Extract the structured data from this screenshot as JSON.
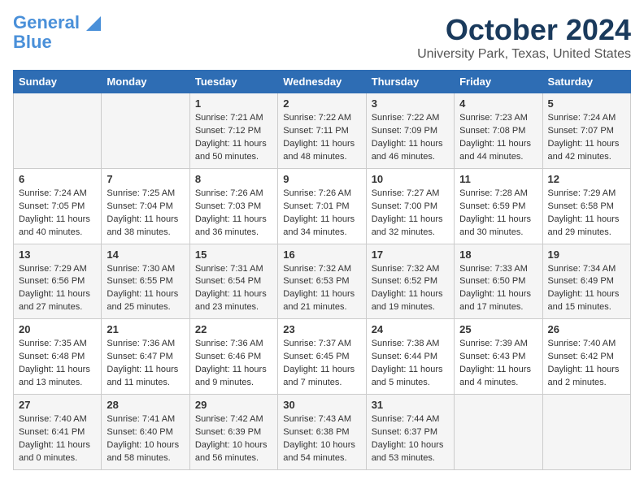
{
  "logo": {
    "line1": "General",
    "line2": "Blue"
  },
  "title": "October 2024",
  "location": "University Park, Texas, United States",
  "days_header": [
    "Sunday",
    "Monday",
    "Tuesday",
    "Wednesday",
    "Thursday",
    "Friday",
    "Saturday"
  ],
  "weeks": [
    [
      {
        "day": "",
        "sunrise": "",
        "sunset": "",
        "daylight": ""
      },
      {
        "day": "",
        "sunrise": "",
        "sunset": "",
        "daylight": ""
      },
      {
        "day": "1",
        "sunrise": "Sunrise: 7:21 AM",
        "sunset": "Sunset: 7:12 PM",
        "daylight": "Daylight: 11 hours and 50 minutes."
      },
      {
        "day": "2",
        "sunrise": "Sunrise: 7:22 AM",
        "sunset": "Sunset: 7:11 PM",
        "daylight": "Daylight: 11 hours and 48 minutes."
      },
      {
        "day": "3",
        "sunrise": "Sunrise: 7:22 AM",
        "sunset": "Sunset: 7:09 PM",
        "daylight": "Daylight: 11 hours and 46 minutes."
      },
      {
        "day": "4",
        "sunrise": "Sunrise: 7:23 AM",
        "sunset": "Sunset: 7:08 PM",
        "daylight": "Daylight: 11 hours and 44 minutes."
      },
      {
        "day": "5",
        "sunrise": "Sunrise: 7:24 AM",
        "sunset": "Sunset: 7:07 PM",
        "daylight": "Daylight: 11 hours and 42 minutes."
      }
    ],
    [
      {
        "day": "6",
        "sunrise": "Sunrise: 7:24 AM",
        "sunset": "Sunset: 7:05 PM",
        "daylight": "Daylight: 11 hours and 40 minutes."
      },
      {
        "day": "7",
        "sunrise": "Sunrise: 7:25 AM",
        "sunset": "Sunset: 7:04 PM",
        "daylight": "Daylight: 11 hours and 38 minutes."
      },
      {
        "day": "8",
        "sunrise": "Sunrise: 7:26 AM",
        "sunset": "Sunset: 7:03 PM",
        "daylight": "Daylight: 11 hours and 36 minutes."
      },
      {
        "day": "9",
        "sunrise": "Sunrise: 7:26 AM",
        "sunset": "Sunset: 7:01 PM",
        "daylight": "Daylight: 11 hours and 34 minutes."
      },
      {
        "day": "10",
        "sunrise": "Sunrise: 7:27 AM",
        "sunset": "Sunset: 7:00 PM",
        "daylight": "Daylight: 11 hours and 32 minutes."
      },
      {
        "day": "11",
        "sunrise": "Sunrise: 7:28 AM",
        "sunset": "Sunset: 6:59 PM",
        "daylight": "Daylight: 11 hours and 30 minutes."
      },
      {
        "day": "12",
        "sunrise": "Sunrise: 7:29 AM",
        "sunset": "Sunset: 6:58 PM",
        "daylight": "Daylight: 11 hours and 29 minutes."
      }
    ],
    [
      {
        "day": "13",
        "sunrise": "Sunrise: 7:29 AM",
        "sunset": "Sunset: 6:56 PM",
        "daylight": "Daylight: 11 hours and 27 minutes."
      },
      {
        "day": "14",
        "sunrise": "Sunrise: 7:30 AM",
        "sunset": "Sunset: 6:55 PM",
        "daylight": "Daylight: 11 hours and 25 minutes."
      },
      {
        "day": "15",
        "sunrise": "Sunrise: 7:31 AM",
        "sunset": "Sunset: 6:54 PM",
        "daylight": "Daylight: 11 hours and 23 minutes."
      },
      {
        "day": "16",
        "sunrise": "Sunrise: 7:32 AM",
        "sunset": "Sunset: 6:53 PM",
        "daylight": "Daylight: 11 hours and 21 minutes."
      },
      {
        "day": "17",
        "sunrise": "Sunrise: 7:32 AM",
        "sunset": "Sunset: 6:52 PM",
        "daylight": "Daylight: 11 hours and 19 minutes."
      },
      {
        "day": "18",
        "sunrise": "Sunrise: 7:33 AM",
        "sunset": "Sunset: 6:50 PM",
        "daylight": "Daylight: 11 hours and 17 minutes."
      },
      {
        "day": "19",
        "sunrise": "Sunrise: 7:34 AM",
        "sunset": "Sunset: 6:49 PM",
        "daylight": "Daylight: 11 hours and 15 minutes."
      }
    ],
    [
      {
        "day": "20",
        "sunrise": "Sunrise: 7:35 AM",
        "sunset": "Sunset: 6:48 PM",
        "daylight": "Daylight: 11 hours and 13 minutes."
      },
      {
        "day": "21",
        "sunrise": "Sunrise: 7:36 AM",
        "sunset": "Sunset: 6:47 PM",
        "daylight": "Daylight: 11 hours and 11 minutes."
      },
      {
        "day": "22",
        "sunrise": "Sunrise: 7:36 AM",
        "sunset": "Sunset: 6:46 PM",
        "daylight": "Daylight: 11 hours and 9 minutes."
      },
      {
        "day": "23",
        "sunrise": "Sunrise: 7:37 AM",
        "sunset": "Sunset: 6:45 PM",
        "daylight": "Daylight: 11 hours and 7 minutes."
      },
      {
        "day": "24",
        "sunrise": "Sunrise: 7:38 AM",
        "sunset": "Sunset: 6:44 PM",
        "daylight": "Daylight: 11 hours and 5 minutes."
      },
      {
        "day": "25",
        "sunrise": "Sunrise: 7:39 AM",
        "sunset": "Sunset: 6:43 PM",
        "daylight": "Daylight: 11 hours and 4 minutes."
      },
      {
        "day": "26",
        "sunrise": "Sunrise: 7:40 AM",
        "sunset": "Sunset: 6:42 PM",
        "daylight": "Daylight: 11 hours and 2 minutes."
      }
    ],
    [
      {
        "day": "27",
        "sunrise": "Sunrise: 7:40 AM",
        "sunset": "Sunset: 6:41 PM",
        "daylight": "Daylight: 11 hours and 0 minutes."
      },
      {
        "day": "28",
        "sunrise": "Sunrise: 7:41 AM",
        "sunset": "Sunset: 6:40 PM",
        "daylight": "Daylight: 10 hours and 58 minutes."
      },
      {
        "day": "29",
        "sunrise": "Sunrise: 7:42 AM",
        "sunset": "Sunset: 6:39 PM",
        "daylight": "Daylight: 10 hours and 56 minutes."
      },
      {
        "day": "30",
        "sunrise": "Sunrise: 7:43 AM",
        "sunset": "Sunset: 6:38 PM",
        "daylight": "Daylight: 10 hours and 54 minutes."
      },
      {
        "day": "31",
        "sunrise": "Sunrise: 7:44 AM",
        "sunset": "Sunset: 6:37 PM",
        "daylight": "Daylight: 10 hours and 53 minutes."
      },
      {
        "day": "",
        "sunrise": "",
        "sunset": "",
        "daylight": ""
      },
      {
        "day": "",
        "sunrise": "",
        "sunset": "",
        "daylight": ""
      }
    ]
  ]
}
